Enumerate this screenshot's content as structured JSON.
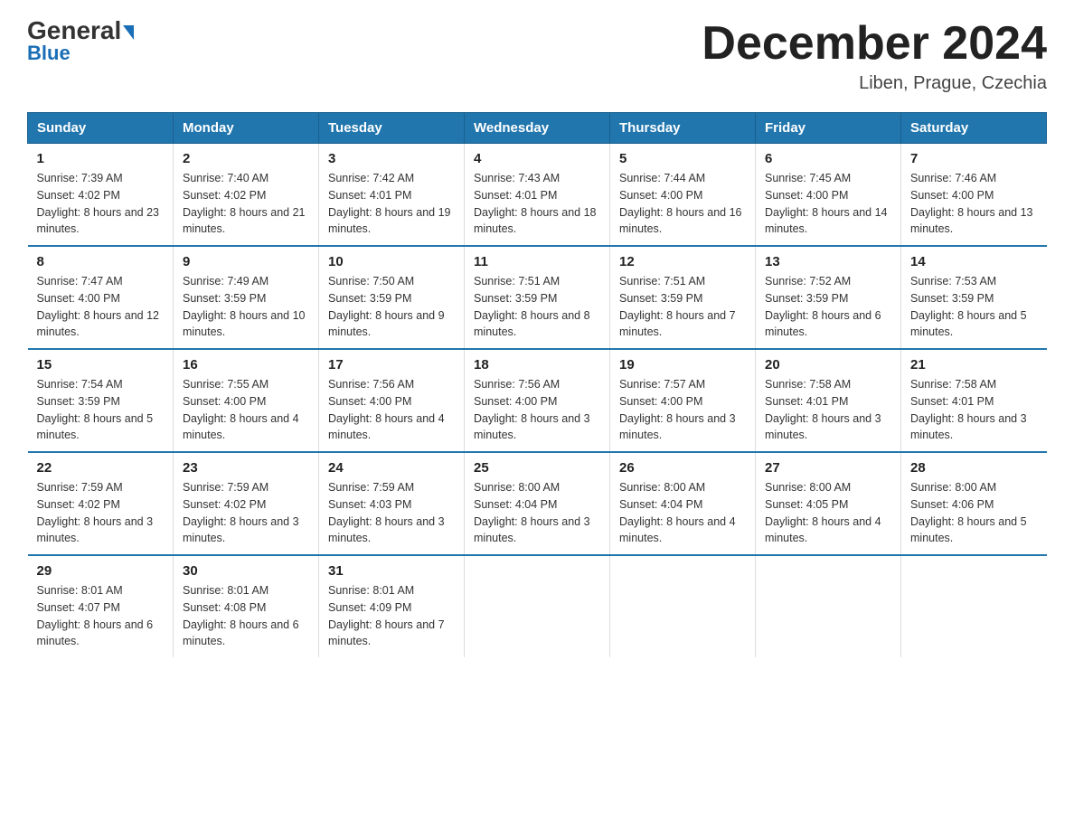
{
  "logo": {
    "top": "General",
    "bottom": "Blue"
  },
  "header": {
    "month": "December 2024",
    "location": "Liben, Prague, Czechia"
  },
  "weekdays": [
    "Sunday",
    "Monday",
    "Tuesday",
    "Wednesday",
    "Thursday",
    "Friday",
    "Saturday"
  ],
  "weeks": [
    [
      {
        "day": "1",
        "sunrise": "7:39 AM",
        "sunset": "4:02 PM",
        "daylight": "8 hours and 23 minutes."
      },
      {
        "day": "2",
        "sunrise": "7:40 AM",
        "sunset": "4:02 PM",
        "daylight": "8 hours and 21 minutes."
      },
      {
        "day": "3",
        "sunrise": "7:42 AM",
        "sunset": "4:01 PM",
        "daylight": "8 hours and 19 minutes."
      },
      {
        "day": "4",
        "sunrise": "7:43 AM",
        "sunset": "4:01 PM",
        "daylight": "8 hours and 18 minutes."
      },
      {
        "day": "5",
        "sunrise": "7:44 AM",
        "sunset": "4:00 PM",
        "daylight": "8 hours and 16 minutes."
      },
      {
        "day": "6",
        "sunrise": "7:45 AM",
        "sunset": "4:00 PM",
        "daylight": "8 hours and 14 minutes."
      },
      {
        "day": "7",
        "sunrise": "7:46 AM",
        "sunset": "4:00 PM",
        "daylight": "8 hours and 13 minutes."
      }
    ],
    [
      {
        "day": "8",
        "sunrise": "7:47 AM",
        "sunset": "4:00 PM",
        "daylight": "8 hours and 12 minutes."
      },
      {
        "day": "9",
        "sunrise": "7:49 AM",
        "sunset": "3:59 PM",
        "daylight": "8 hours and 10 minutes."
      },
      {
        "day": "10",
        "sunrise": "7:50 AM",
        "sunset": "3:59 PM",
        "daylight": "8 hours and 9 minutes."
      },
      {
        "day": "11",
        "sunrise": "7:51 AM",
        "sunset": "3:59 PM",
        "daylight": "8 hours and 8 minutes."
      },
      {
        "day": "12",
        "sunrise": "7:51 AM",
        "sunset": "3:59 PM",
        "daylight": "8 hours and 7 minutes."
      },
      {
        "day": "13",
        "sunrise": "7:52 AM",
        "sunset": "3:59 PM",
        "daylight": "8 hours and 6 minutes."
      },
      {
        "day": "14",
        "sunrise": "7:53 AM",
        "sunset": "3:59 PM",
        "daylight": "8 hours and 5 minutes."
      }
    ],
    [
      {
        "day": "15",
        "sunrise": "7:54 AM",
        "sunset": "3:59 PM",
        "daylight": "8 hours and 5 minutes."
      },
      {
        "day": "16",
        "sunrise": "7:55 AM",
        "sunset": "4:00 PM",
        "daylight": "8 hours and 4 minutes."
      },
      {
        "day": "17",
        "sunrise": "7:56 AM",
        "sunset": "4:00 PM",
        "daylight": "8 hours and 4 minutes."
      },
      {
        "day": "18",
        "sunrise": "7:56 AM",
        "sunset": "4:00 PM",
        "daylight": "8 hours and 3 minutes."
      },
      {
        "day": "19",
        "sunrise": "7:57 AM",
        "sunset": "4:00 PM",
        "daylight": "8 hours and 3 minutes."
      },
      {
        "day": "20",
        "sunrise": "7:58 AM",
        "sunset": "4:01 PM",
        "daylight": "8 hours and 3 minutes."
      },
      {
        "day": "21",
        "sunrise": "7:58 AM",
        "sunset": "4:01 PM",
        "daylight": "8 hours and 3 minutes."
      }
    ],
    [
      {
        "day": "22",
        "sunrise": "7:59 AM",
        "sunset": "4:02 PM",
        "daylight": "8 hours and 3 minutes."
      },
      {
        "day": "23",
        "sunrise": "7:59 AM",
        "sunset": "4:02 PM",
        "daylight": "8 hours and 3 minutes."
      },
      {
        "day": "24",
        "sunrise": "7:59 AM",
        "sunset": "4:03 PM",
        "daylight": "8 hours and 3 minutes."
      },
      {
        "day": "25",
        "sunrise": "8:00 AM",
        "sunset": "4:04 PM",
        "daylight": "8 hours and 3 minutes."
      },
      {
        "day": "26",
        "sunrise": "8:00 AM",
        "sunset": "4:04 PM",
        "daylight": "8 hours and 4 minutes."
      },
      {
        "day": "27",
        "sunrise": "8:00 AM",
        "sunset": "4:05 PM",
        "daylight": "8 hours and 4 minutes."
      },
      {
        "day": "28",
        "sunrise": "8:00 AM",
        "sunset": "4:06 PM",
        "daylight": "8 hours and 5 minutes."
      }
    ],
    [
      {
        "day": "29",
        "sunrise": "8:01 AM",
        "sunset": "4:07 PM",
        "daylight": "8 hours and 6 minutes."
      },
      {
        "day": "30",
        "sunrise": "8:01 AM",
        "sunset": "4:08 PM",
        "daylight": "8 hours and 6 minutes."
      },
      {
        "day": "31",
        "sunrise": "8:01 AM",
        "sunset": "4:09 PM",
        "daylight": "8 hours and 7 minutes."
      },
      null,
      null,
      null,
      null
    ]
  ]
}
